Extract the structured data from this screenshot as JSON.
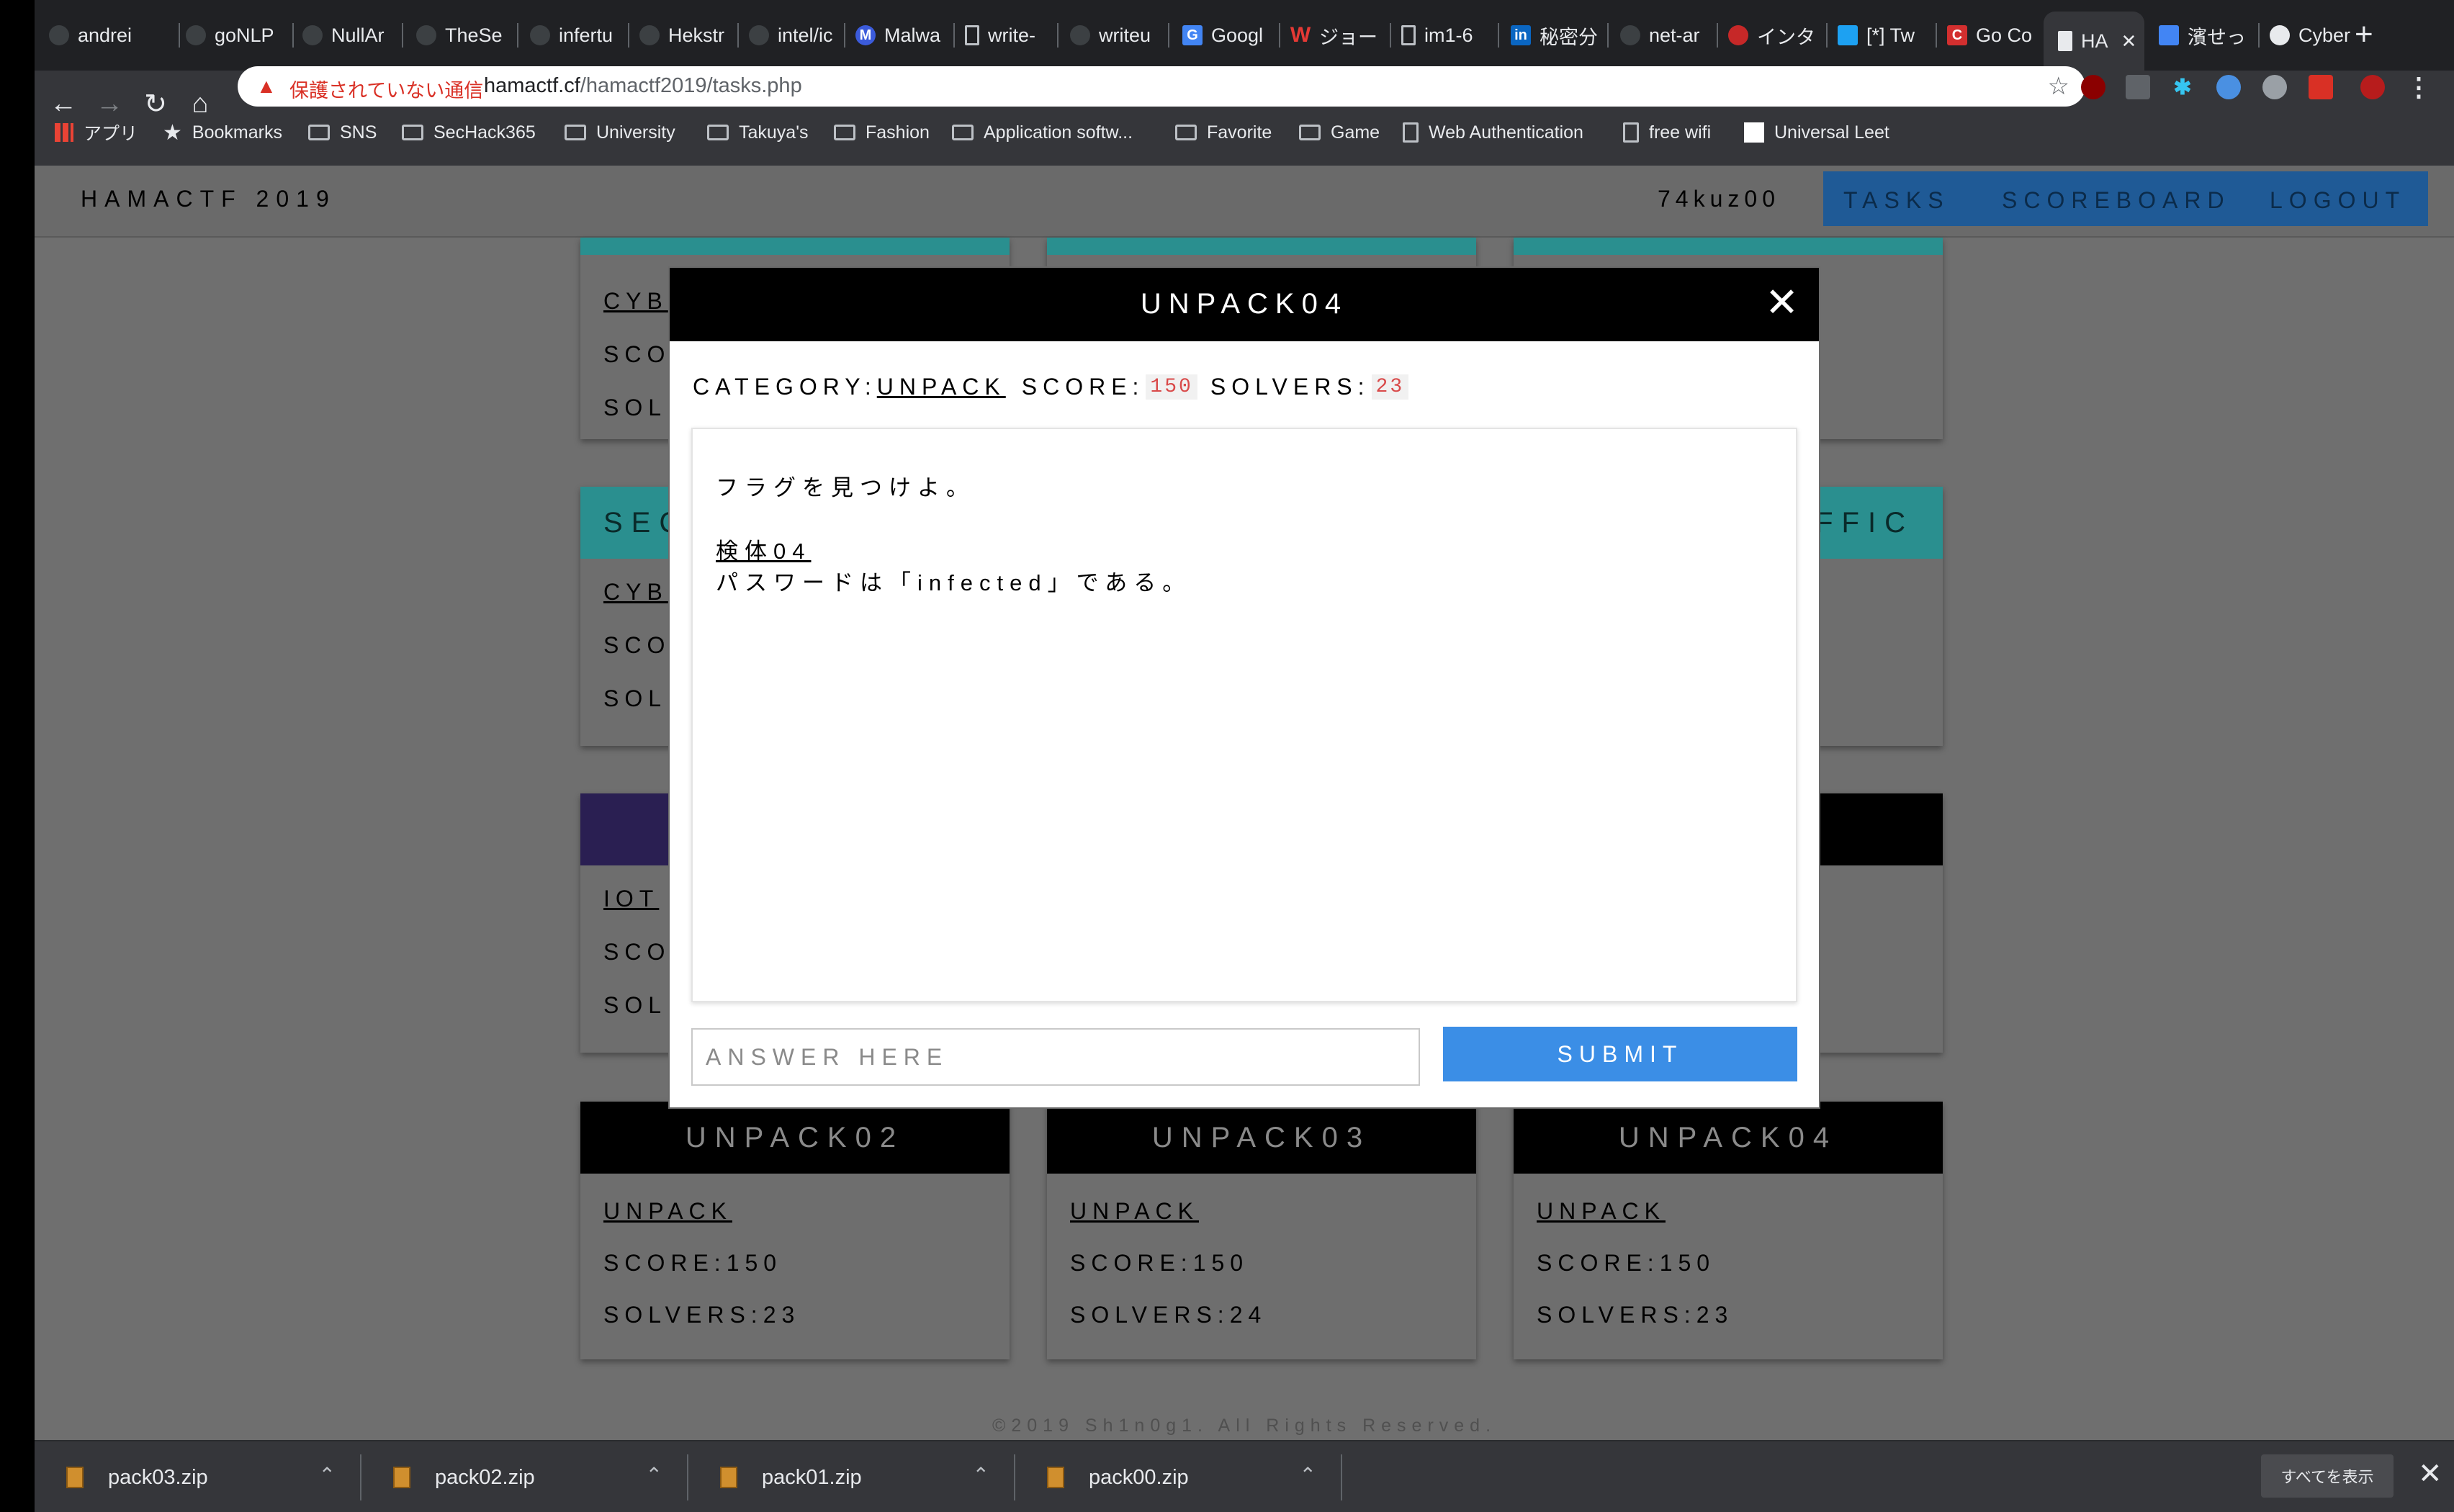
{
  "browser": {
    "tabs": [
      {
        "label": "andrei"
      },
      {
        "label": "goNLP"
      },
      {
        "label": "NullAr"
      },
      {
        "label": "TheSe"
      },
      {
        "label": "infertu"
      },
      {
        "label": "Hekstr"
      },
      {
        "label": "intel/ic"
      },
      {
        "label": "Malwa"
      },
      {
        "label": "write-"
      },
      {
        "label": "writeu"
      },
      {
        "label": "Googl"
      },
      {
        "label": "ジョー"
      },
      {
        "label": "im1-6"
      },
      {
        "label": "秘密分"
      },
      {
        "label": "net-ar"
      },
      {
        "label": "インタ"
      },
      {
        "label": "[*] Tw"
      },
      {
        "label": "Go Co"
      },
      {
        "label": "HA"
      },
      {
        "label": "濱せっ"
      },
      {
        "label": "Cyber"
      }
    ],
    "new_tab": "+",
    "security_warning": "保護されていない通信",
    "url_host": "hamactf.cf",
    "url_path": "/hamactf2019/tasks.php",
    "bookmarks": [
      {
        "label": "アプリ"
      },
      {
        "label": "Bookmarks"
      },
      {
        "label": "SNS"
      },
      {
        "label": "SecHack365"
      },
      {
        "label": "University"
      },
      {
        "label": "Takuya's"
      },
      {
        "label": "Fashion"
      },
      {
        "label": "Application softw..."
      },
      {
        "label": "Favorite"
      },
      {
        "label": "Game"
      },
      {
        "label": "Web Authentication"
      },
      {
        "label": "free wifi"
      },
      {
        "label": "Universal Leet"
      }
    ]
  },
  "site": {
    "brand": "HAMACTF 2019",
    "username": "74kuz00",
    "nav": {
      "tasks": "TASKS",
      "scoreboard": "SCOREBOARD",
      "logout": "LOGOUT"
    },
    "footer": "©2019 Sh1n0g1. All Rights Reserved."
  },
  "cards_partial": {
    "row1_cat": "CYB",
    "row2_title_left": "SEC",
    "row2_title_right": "FFIC",
    "row2_cat": "CYB",
    "row3_cat": "IOT",
    "sco": "SCO",
    "sol": "SOL"
  },
  "cards": [
    {
      "title": "UNPACK02",
      "category": "UNPACK",
      "score": "SCORE:150",
      "solvers": "SOLVERS:23"
    },
    {
      "title": "UNPACK03",
      "category": "UNPACK",
      "score": "SCORE:150",
      "solvers": "SOLVERS:24"
    },
    {
      "title": "UNPACK04",
      "category": "UNPACK",
      "score": "SCORE:150",
      "solvers": "SOLVERS:23"
    }
  ],
  "modal": {
    "title": "UNPACK04",
    "close": "✕",
    "category_label": "CATEGORY:",
    "category": "UNPACK",
    "score_label": "SCORE:",
    "score": "150",
    "solvers_label": "SOLVERS:",
    "solvers": "23",
    "description_line1": "フラグを見つけよ。",
    "download_link": "検体04",
    "password_line": "パスワードは「infected」である。",
    "answer_placeholder": "ANSWER HERE",
    "submit": "SUBMIT"
  },
  "downloads": {
    "files": [
      {
        "name": "pack03.zip"
      },
      {
        "name": "pack02.zip"
      },
      {
        "name": "pack01.zip"
      },
      {
        "name": "pack00.zip"
      }
    ],
    "show_all": "すべてを表示",
    "close": "✕"
  },
  "colors": {
    "modal_header": "#000000",
    "submit": "#3b8ee6",
    "nav_bg": "#1f5a96",
    "pill_text": "#d94a4a"
  }
}
